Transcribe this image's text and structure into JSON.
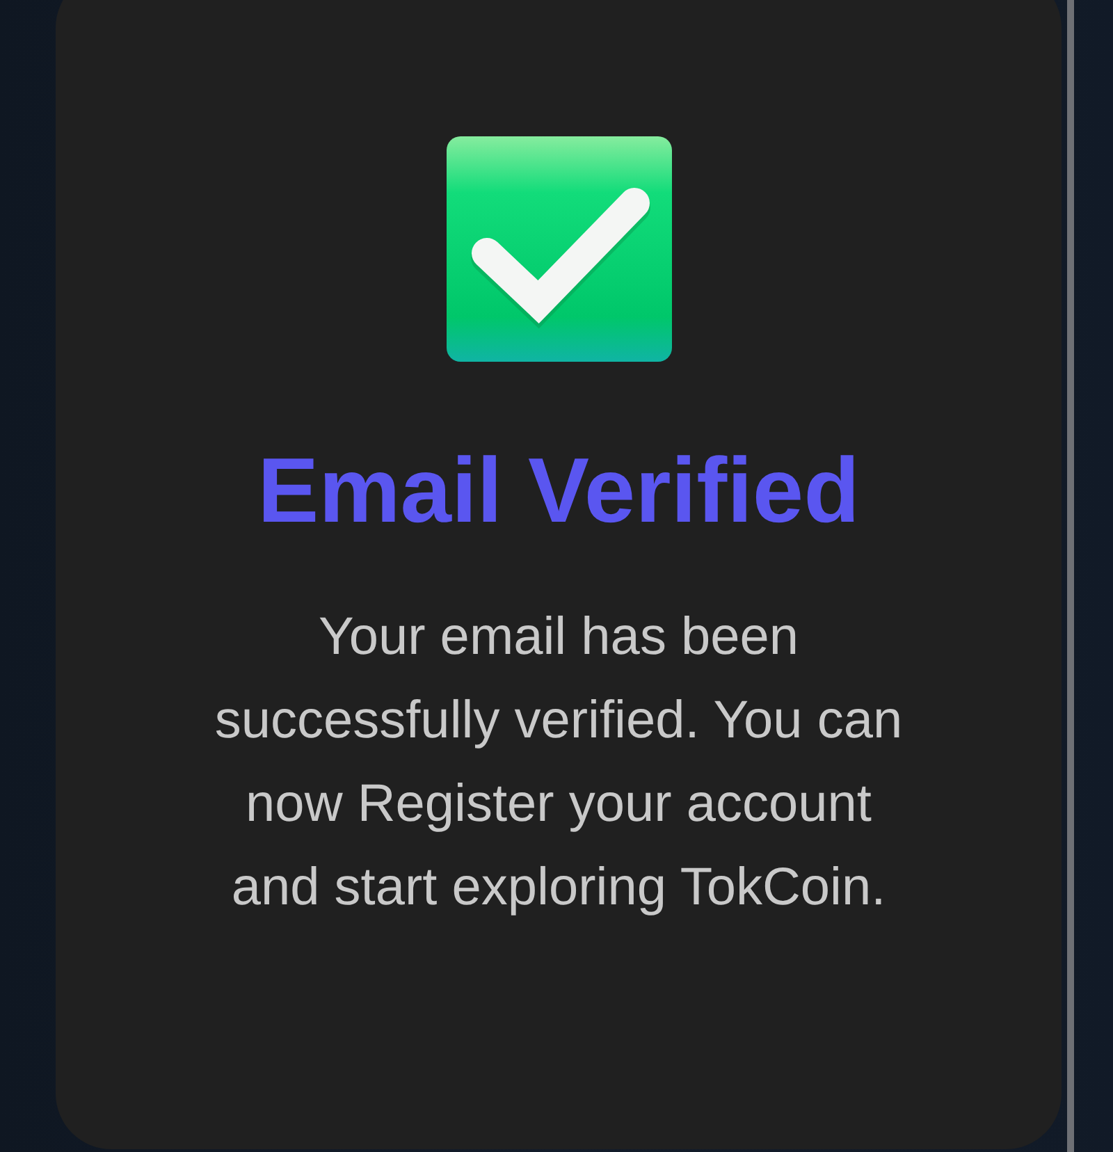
{
  "card": {
    "title": "Email Verified",
    "message": "Your email has been successfully verified. You can now Register your account and start exploring TokCoin."
  }
}
